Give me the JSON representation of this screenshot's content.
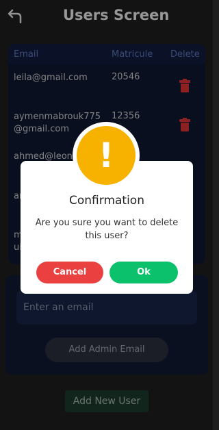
{
  "header": {
    "title": "Users Screen",
    "back_icon": "back-arrow-icon"
  },
  "table": {
    "columns": {
      "email": "Email",
      "matricule": "Matricule",
      "delete": "Delete"
    },
    "rows": [
      {
        "email": "leila@gmail.com",
        "matricule": "20546"
      },
      {
        "email": "aymenmabrouk775@gmail.com",
        "matricule": "12356"
      },
      {
        "email": "ahmed@leon",
        "matricule": ""
      },
      {
        "email": "ar",
        "matricule": ""
      },
      {
        "email": "m",
        "email2": "ui",
        "matricule": ""
      }
    ],
    "delete_icon": "trash-icon",
    "delete_color": "#d93232"
  },
  "add_email": {
    "placeholder": "Enter an email",
    "button": "Add Admin Email"
  },
  "add_user": {
    "button": "Add New User"
  },
  "dialog": {
    "icon": "warning-icon",
    "icon_glyph": "!",
    "title": "Confirmation",
    "message": "Are you sure you want to delete this user?",
    "cancel": "Cancel",
    "ok": "Ok",
    "colors": {
      "warning": "#f7b200",
      "cancel": "#ea4040",
      "ok": "#0bc16b"
    }
  }
}
